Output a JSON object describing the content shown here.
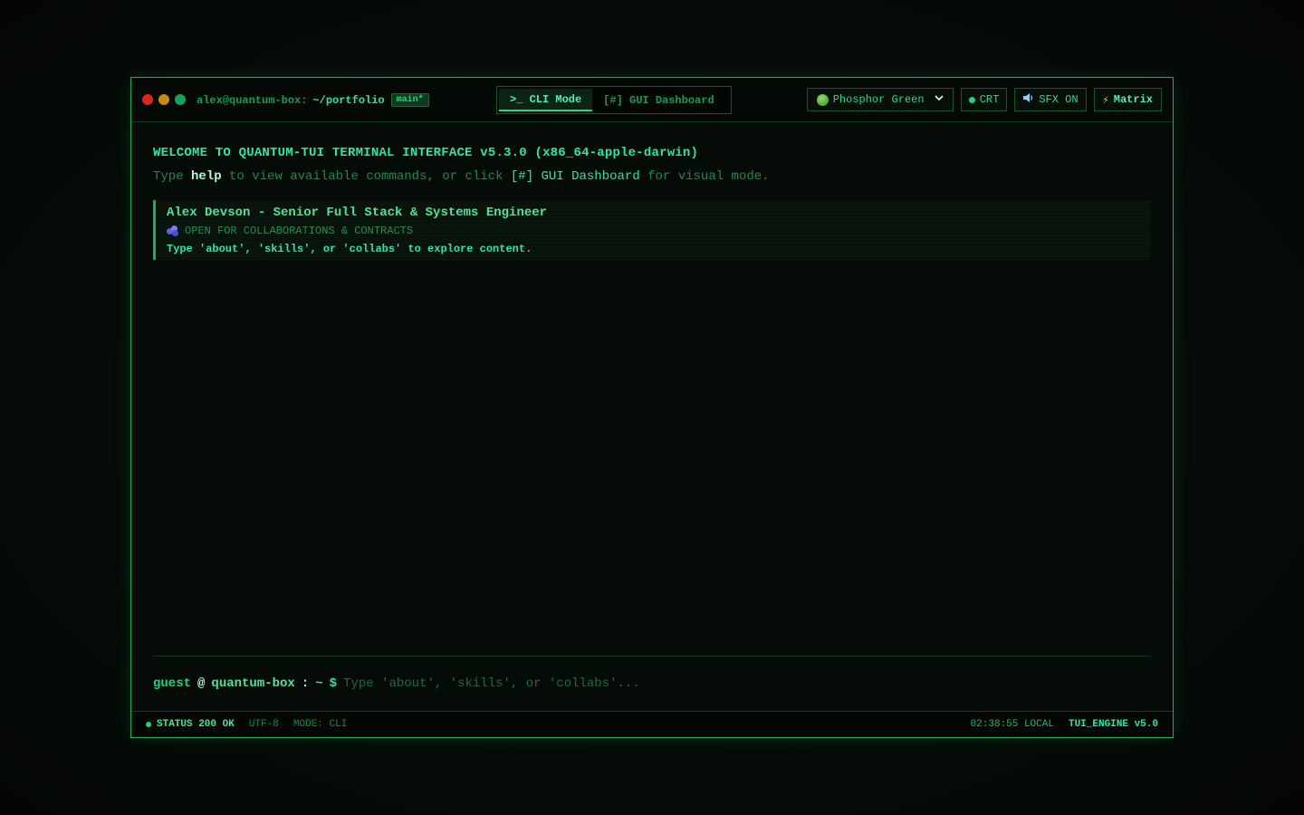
{
  "colors": {
    "accent": "#1fae5a",
    "bright": "#2ee6a6",
    "background": "#050c08"
  },
  "titlebar": {
    "user_host": "alex@quantum-box:",
    "cwd": "~/portfolio",
    "branch": "main*"
  },
  "modes": {
    "cli_label": ">_ CLI Mode",
    "gui_label": "[#] GUI Dashboard"
  },
  "controls": {
    "theme_label": "Phosphor Green",
    "theme_icon": "green-orb-icon",
    "crt_label": "CRT",
    "sfx_label": "SFX ON",
    "sfx_icon": "speaker-icon",
    "matrix_label": "Matrix",
    "matrix_icon": "lightning-bolt-icon"
  },
  "terminal": {
    "welcome": "WELCOME TO QUANTUM-TUI TERMINAL INTERFACE v5.3.0 (x86_64-apple-darwin)",
    "hint_prefix": "Type",
    "hint_command": "help",
    "hint_middle": "to view available commands, or click",
    "hint_link": "[#] GUI Dashboard",
    "hint_suffix": "for visual mode.",
    "card": {
      "title": "Alex Devson - Senior Full Stack & Systems Engineer",
      "status": "OPEN FOR COLLABORATIONS & CONTRACTS",
      "explore": "Type 'about', 'skills', or 'collabs' to explore content."
    }
  },
  "prompt": {
    "user": "guest",
    "at": "@",
    "host": "quantum-box",
    "colon": ":",
    "dir": "~",
    "symbol": "$",
    "placeholder": "Type 'about', 'skills', or 'collabs'..."
  },
  "statusbar": {
    "status": "STATUS 200 OK",
    "encoding": "UTF-8",
    "mode": "MODE: CLI",
    "time": "02:38:55 LOCAL",
    "engine": "TUI_ENGINE v5.0"
  }
}
